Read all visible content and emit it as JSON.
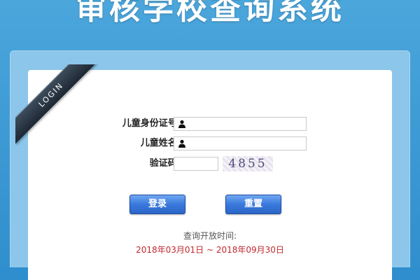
{
  "header": {
    "title": "审核学校查询系统"
  },
  "ribbon": {
    "label": "LOGIN"
  },
  "form": {
    "id_label": "儿童身份证号:",
    "id_value": "",
    "name_label": "儿童姓名:",
    "name_value": "",
    "captcha_label": "验证码:",
    "captcha_value": "",
    "captcha_code": "4855"
  },
  "buttons": {
    "login_label": "登录",
    "reset_label": "重置"
  },
  "query_period": {
    "label": "查询开放时间:",
    "range": "2018年03月01日 ~ 2018年09月30日"
  },
  "colors": {
    "background": "#3b97d2",
    "button": "#3a79dc",
    "date_text": "#c0292f"
  }
}
